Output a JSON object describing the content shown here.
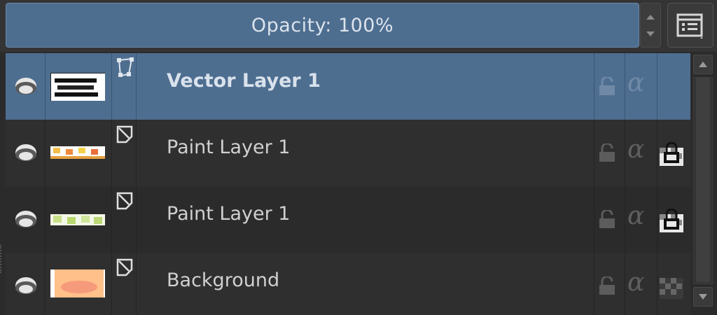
{
  "opacity": {
    "label": "Opacity:",
    "value": "100%"
  },
  "icons": {
    "spinbox": "spin-up-down-icon",
    "options": "layer-options-icon",
    "visibility": "eye-icon",
    "vector_type": "vector-layer-icon",
    "paint_type": "paint-layer-icon",
    "lock": "lock-icon",
    "alpha": "alpha-lock-icon",
    "inherit_alpha": "inherit-alpha-icon",
    "scroll_up": "scroll-up-arrow-icon",
    "scroll_down": "scroll-down-arrow-icon"
  },
  "colors": {
    "accent": "#4e6e90",
    "background": "#2b2b2b",
    "text": "#d0d0d0"
  },
  "layers": [
    {
      "name": "Vector Layer 1",
      "type": "vector",
      "selected": true,
      "alpha_symbol": "α"
    },
    {
      "name": "Paint Layer 1",
      "type": "paint",
      "selected": false,
      "alpha_symbol": "α"
    },
    {
      "name": "Paint Layer 1",
      "type": "paint",
      "selected": false,
      "alpha_symbol": "α"
    },
    {
      "name": "Background",
      "type": "paint",
      "selected": false,
      "alpha_symbol": "α"
    }
  ]
}
